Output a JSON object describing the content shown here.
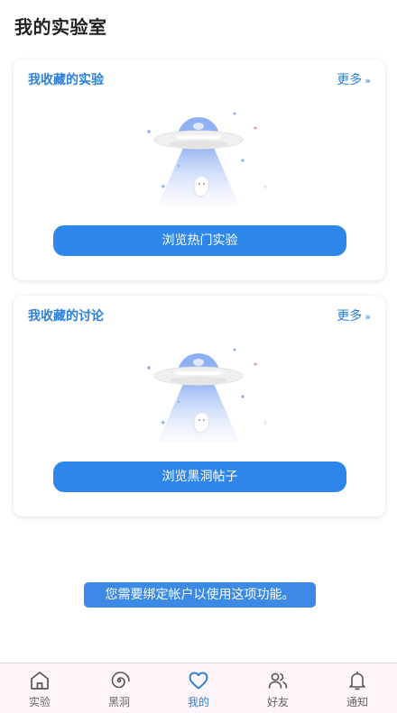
{
  "page": {
    "title": "我的实验室"
  },
  "cards": [
    {
      "title": "我收藏的实验",
      "more": "更多",
      "button": "浏览热门实验"
    },
    {
      "title": "我收藏的讨论",
      "more": "更多",
      "button": "浏览黑洞帖子"
    }
  ],
  "toast": "您需要绑定帐户以使用这项功能。",
  "tabbar": {
    "tabs": [
      {
        "label": "实验",
        "icon": "home-icon"
      },
      {
        "label": "黑洞",
        "icon": "spiral-icon"
      },
      {
        "label": "我的",
        "icon": "heart-icon",
        "active": true
      },
      {
        "label": "好友",
        "icon": "friends-icon"
      },
      {
        "label": "通知",
        "icon": "bell-icon"
      }
    ]
  },
  "colors": {
    "accent": "#2b7fd8",
    "button": "#2f86ea",
    "tabbar_bg": "#fdf5f9"
  }
}
